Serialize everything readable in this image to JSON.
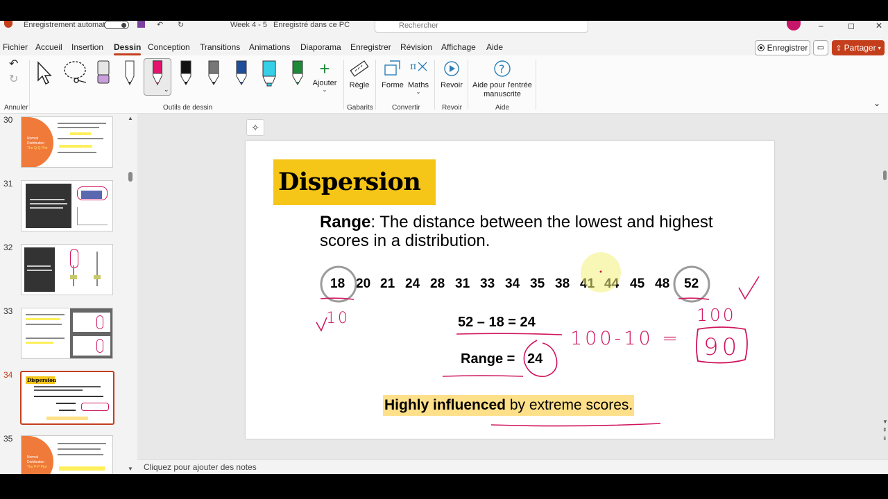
{
  "titlebar": {
    "autosave_label": "Enregistrement automatique",
    "file_name": "Week 4 - 5",
    "save_status": "Enregistré dans ce PC",
    "search_placeholder": "Rechercher"
  },
  "menu": {
    "tabs": [
      "Fichier",
      "Accueil",
      "Insertion",
      "Dessin",
      "Conception",
      "Transitions",
      "Animations",
      "Diaporama",
      "Enregistrer",
      "Révision",
      "Affichage",
      "Aide"
    ],
    "active_tab": "Dessin",
    "record_button": "Enregistrer",
    "share_button": "Partager"
  },
  "ribbon": {
    "groups": {
      "undo": "Annuler",
      "drawing_tools": "Outils de dessin",
      "stencils": "Gabarits",
      "convert": "Convertir",
      "replay": "Revoir",
      "help": "Aide"
    },
    "buttons": {
      "add": "Ajouter",
      "ruler": "Règle",
      "shape": "Forme",
      "math": "Maths",
      "replay": "Revoir",
      "ink_help_line1": "Aide pour l'entrée",
      "ink_help_line2": "manuscrite"
    },
    "pen_colors": {
      "selected": "#e5126e",
      "black": "#111111",
      "gray": "#777777",
      "blue": "#1f4e9c",
      "cyan": "#35d0e8",
      "green": "#1d8a3a"
    }
  },
  "slides": {
    "numbers": [
      "30",
      "31",
      "32",
      "33",
      "34",
      "35"
    ],
    "active": "34",
    "thumb30": {
      "line1": "Normal",
      "line2": "Distribution",
      "line3": "The Q-Q Plot"
    },
    "thumb35": {
      "line1": "Normal",
      "line2": "Distribution",
      "line3": "The P-P Plot"
    },
    "thumb34": {
      "title": "Dispersion"
    }
  },
  "notes_placeholder": "Cliquez pour ajouter des notes",
  "slide": {
    "title": "Dispersion",
    "range_term": "Range",
    "range_definition": ": The distance between the lowest and highest scores in a distribution.",
    "scores": [
      "18",
      "20",
      "21",
      "24",
      "28",
      "31",
      "33",
      "34",
      "35",
      "38",
      "41",
      "44",
      "45",
      "48",
      "52"
    ],
    "calc_line": "52 – 18 =  24",
    "range_result_label": "Range = ",
    "range_result_value": "24",
    "footer_bold": "Highly influenced",
    "footer_rest": " by extreme scores.",
    "handwriting": {
      "low": "10",
      "high": "100",
      "expression": "100-10 =",
      "answer": "90"
    }
  },
  "colors": {
    "accent": "#c43e1c",
    "title_bg": "#f5c518",
    "highlight_bg": "#ffe08a",
    "ink": "#d0155f",
    "pointer": "#f4f07a"
  }
}
